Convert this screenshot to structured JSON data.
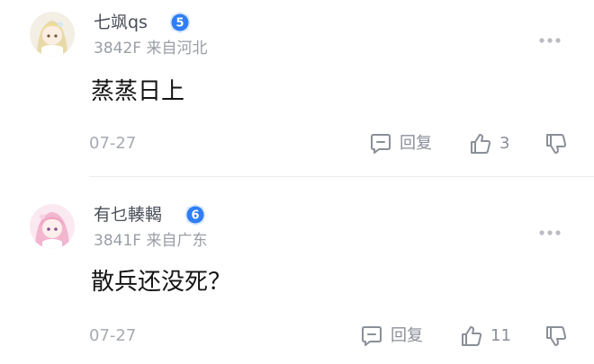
{
  "comments": [
    {
      "username": "七飒qs",
      "level": "5",
      "floor": "3842F",
      "location": "来自河北",
      "text": "蒸蒸日上",
      "date": "07-27",
      "reply_label": "回复",
      "likes": "3",
      "avatar_icon": "anime-girl-blonde-avatar",
      "badge_color": "#2f7ef5"
    },
    {
      "username": "有乜輳輵",
      "level": "6",
      "floor": "3841F",
      "location": "来自广东",
      "text": "散兵还没死？",
      "date": "07-27",
      "reply_label": "回复",
      "likes": "11",
      "avatar_icon": "anime-girl-pink-avatar",
      "badge_color": "#2f7ef5"
    }
  ]
}
